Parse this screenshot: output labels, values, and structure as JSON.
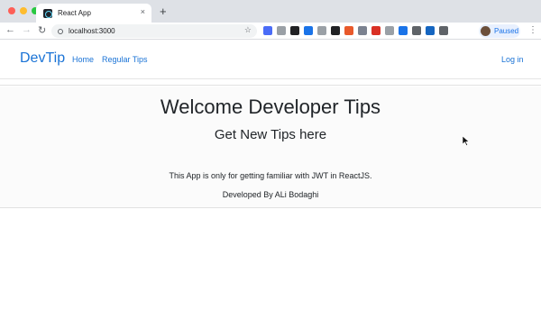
{
  "browser": {
    "tab_title": "React App",
    "tab_close": "×",
    "new_tab": "+",
    "url": "localhost:3000",
    "profile_status": "Paused",
    "traffic_lights": [
      "#fe5f57",
      "#febc2e",
      "#28c840"
    ],
    "extension_colors": [
      "#4a6cf7",
      "#9aa0a6",
      "#202124",
      "#1a73e8",
      "#9aa0a6",
      "#202124",
      "#e8592b",
      "#7b8290",
      "#d93025",
      "#9aa0a6",
      "#1a73e8",
      "#5f6368",
      "#1565c0",
      "#5f6368"
    ]
  },
  "navbar": {
    "brand": "DevTip",
    "links": [
      "Home",
      "Regular Tips"
    ],
    "login": "Log in"
  },
  "main": {
    "title": "Welcome Developer Tips",
    "subtitle": "Get New Tips here",
    "description": "This App is only for getting familiar with JWT in ReactJS.",
    "credit": "Developed By ALi Bodaghi"
  }
}
